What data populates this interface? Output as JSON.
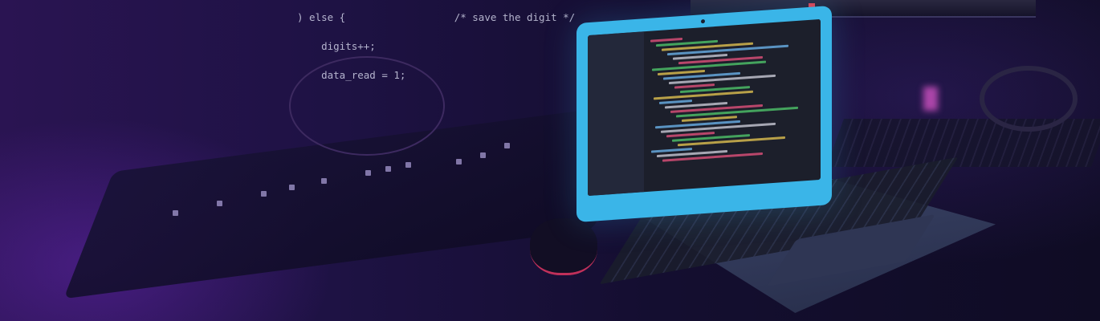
{
  "monitor_code": {
    "line1": ") else {",
    "line2": "    digits++;",
    "line3": "    data_read = 1;",
    "comment": "/* save the digit */"
  }
}
